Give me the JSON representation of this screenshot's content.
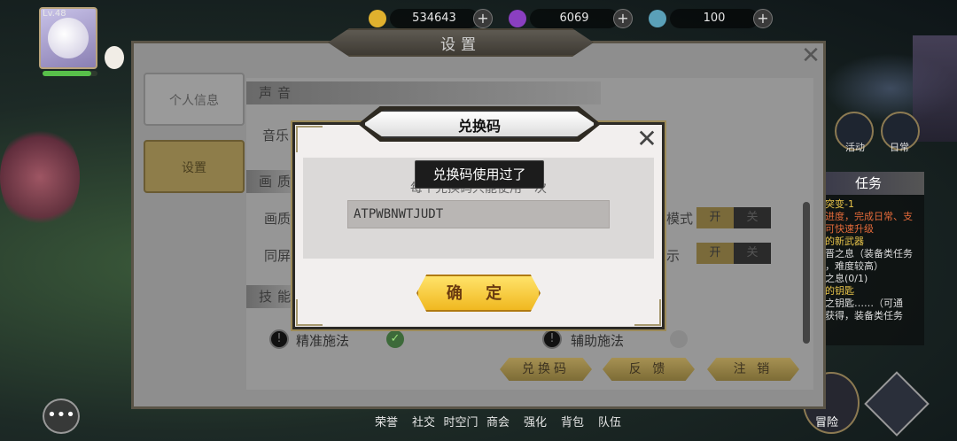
{
  "player": {
    "level": "Lv.48"
  },
  "resources": [
    {
      "name": "gold",
      "value": "534643",
      "color": "#e0b12e"
    },
    {
      "name": "gem",
      "value": "6069",
      "color": "#8a3fc0"
    },
    {
      "name": "energy",
      "value": "100",
      "color": "#5aa0b8"
    }
  ],
  "side_labels": {
    "activity": "活动",
    "daily": "日常"
  },
  "quest": {
    "header": "任务",
    "lines": [
      {
        "text": "突变-1",
        "cls": "y"
      },
      {
        "text": "进度，完成日常、支",
        "cls": "o"
      },
      {
        "text": "可快速升级",
        "cls": "o"
      },
      {
        "text": "的新武器",
        "cls": "y"
      },
      {
        "text": "晋之息（装备类任务",
        "cls": ""
      },
      {
        "text": "，难度较高）",
        "cls": ""
      },
      {
        "text": "之息(0/1)",
        "cls": ""
      },
      {
        "text": "的钥匙",
        "cls": "y"
      },
      {
        "text": "之钥匙……（可通",
        "cls": ""
      },
      {
        "text": "获得，装备类任务",
        "cls": ""
      }
    ]
  },
  "bottom_nav": [
    "荣誉",
    "社交",
    "时空门",
    "商会",
    "强化",
    "背包",
    "队伍"
  ],
  "adventure_label": "冒险",
  "settings": {
    "title": "设置",
    "tabs": {
      "personal": "个人信息",
      "settings": "设置"
    },
    "sections": {
      "sound": "声音",
      "graphics": "画质",
      "skill": "技能"
    },
    "rows": {
      "music": "音乐",
      "quality": "画质",
      "same_screen": "同屏",
      "mode_suffix": "模式",
      "right_suffix": "示"
    },
    "toggle_on": "开",
    "toggle_off": "关",
    "skill_opts": {
      "precise": "精准施法",
      "assist": "辅助施法"
    },
    "buttons": {
      "redeem": "兑换码",
      "feedback": "反 馈",
      "logout": "注 销"
    }
  },
  "modal": {
    "title": "兑换码",
    "hint": "每个兑换码只能使用一次",
    "code_value": "ATPWBNWTJUDT",
    "toast": "兑换码使用过了",
    "confirm": "确 定"
  }
}
